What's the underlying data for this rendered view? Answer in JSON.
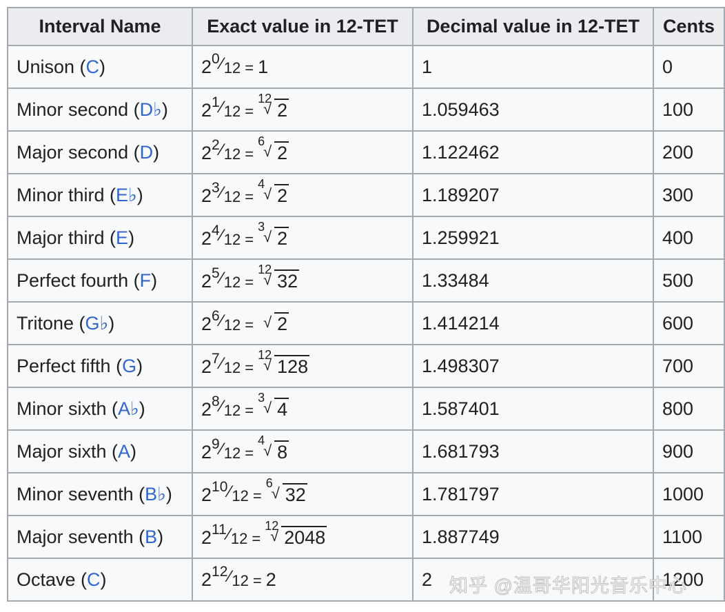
{
  "headers": [
    "Interval Name",
    "Exact value in 12-TET",
    "Decimal value in 12-TET",
    "Cents"
  ],
  "rows": [
    {
      "name": "Unison",
      "note": "C",
      "num": "0",
      "den": "12",
      "index": "",
      "radicand": "",
      "result": "1",
      "decimal": "1",
      "cents": "0"
    },
    {
      "name": "Minor second",
      "note": "D♭",
      "num": "1",
      "den": "12",
      "index": "12",
      "radicand": "2",
      "result": "",
      "decimal": "1.059463",
      "cents": "100"
    },
    {
      "name": "Major second",
      "note": "D",
      "num": "2",
      "den": "12",
      "index": "6",
      "radicand": "2",
      "result": "",
      "decimal": "1.122462",
      "cents": "200"
    },
    {
      "name": "Minor third",
      "note": "E♭",
      "num": "3",
      "den": "12",
      "index": "4",
      "radicand": "2",
      "result": "",
      "decimal": "1.189207",
      "cents": "300"
    },
    {
      "name": "Major third",
      "note": "E",
      "num": "4",
      "den": "12",
      "index": "3",
      "radicand": "2",
      "result": "",
      "decimal": "1.259921",
      "cents": "400"
    },
    {
      "name": "Perfect fourth",
      "note": "F",
      "num": "5",
      "den": "12",
      "index": "12",
      "radicand": "32",
      "result": "",
      "decimal": "1.33484",
      "cents": "500"
    },
    {
      "name": "Tritone",
      "note": "G♭",
      "num": "6",
      "den": "12",
      "index": "",
      "radicand": "2",
      "result": "",
      "decimal": "1.414214",
      "cents": "600"
    },
    {
      "name": "Perfect fifth",
      "note": "G",
      "num": "7",
      "den": "12",
      "index": "12",
      "radicand": "128",
      "result": "",
      "decimal": "1.498307",
      "cents": "700"
    },
    {
      "name": "Minor sixth",
      "note": "A♭",
      "num": "8",
      "den": "12",
      "index": "3",
      "radicand": "4",
      "result": "",
      "decimal": "1.587401",
      "cents": "800"
    },
    {
      "name": "Major sixth",
      "note": "A",
      "num": "9",
      "den": "12",
      "index": "4",
      "radicand": "8",
      "result": "",
      "decimal": "1.681793",
      "cents": "900"
    },
    {
      "name": "Minor seventh",
      "note": "B♭",
      "num": "10",
      "den": "12",
      "index": "6",
      "radicand": "32",
      "result": "",
      "decimal": "1.781797",
      "cents": "1000"
    },
    {
      "name": "Major seventh",
      "note": "B",
      "num": "11",
      "den": "12",
      "index": "12",
      "radicand": "2048",
      "result": "",
      "decimal": "1.887749",
      "cents": "1100"
    },
    {
      "name": "Octave",
      "note": "C",
      "num": "12",
      "den": "12",
      "index": "",
      "radicand": "",
      "result": "2",
      "decimal": "2",
      "cents": "1200"
    }
  ],
  "base": "2",
  "watermark": "知乎 @温哥华阳光音乐中心"
}
